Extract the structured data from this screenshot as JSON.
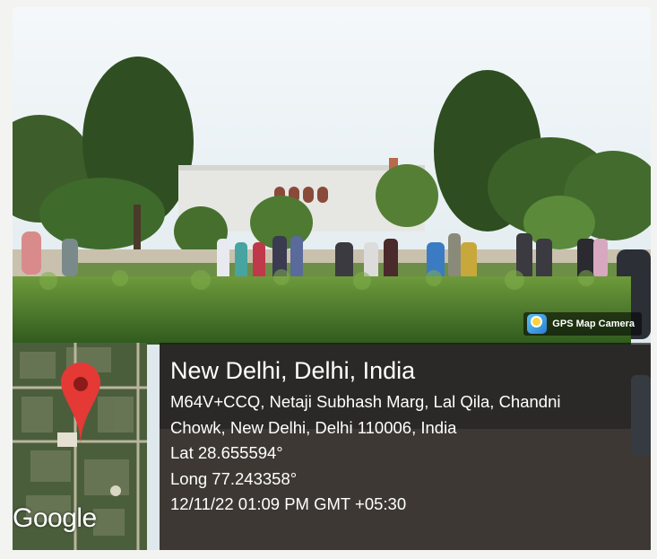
{
  "badge": {
    "label": "GPS Map Camera",
    "icon": "gps-map-camera-icon"
  },
  "map": {
    "logo": "Google",
    "pin_icon": "map-pin-icon"
  },
  "location": {
    "city": "New Delhi, Delhi, India",
    "address_line1": "M64V+CCQ, Netaji Subhash Marg, Lal Qila, Chandni",
    "address_line2": "Chowk, New Delhi, Delhi 110006, India",
    "lat": "Lat 28.655594°",
    "long": "Long 77.243358°",
    "timestamp": "12/11/22 01:09 PM GMT +05:30"
  },
  "colors": {
    "pin": "#e53935",
    "hedge": "#4a7a2c",
    "sky": "#eef4f7"
  }
}
